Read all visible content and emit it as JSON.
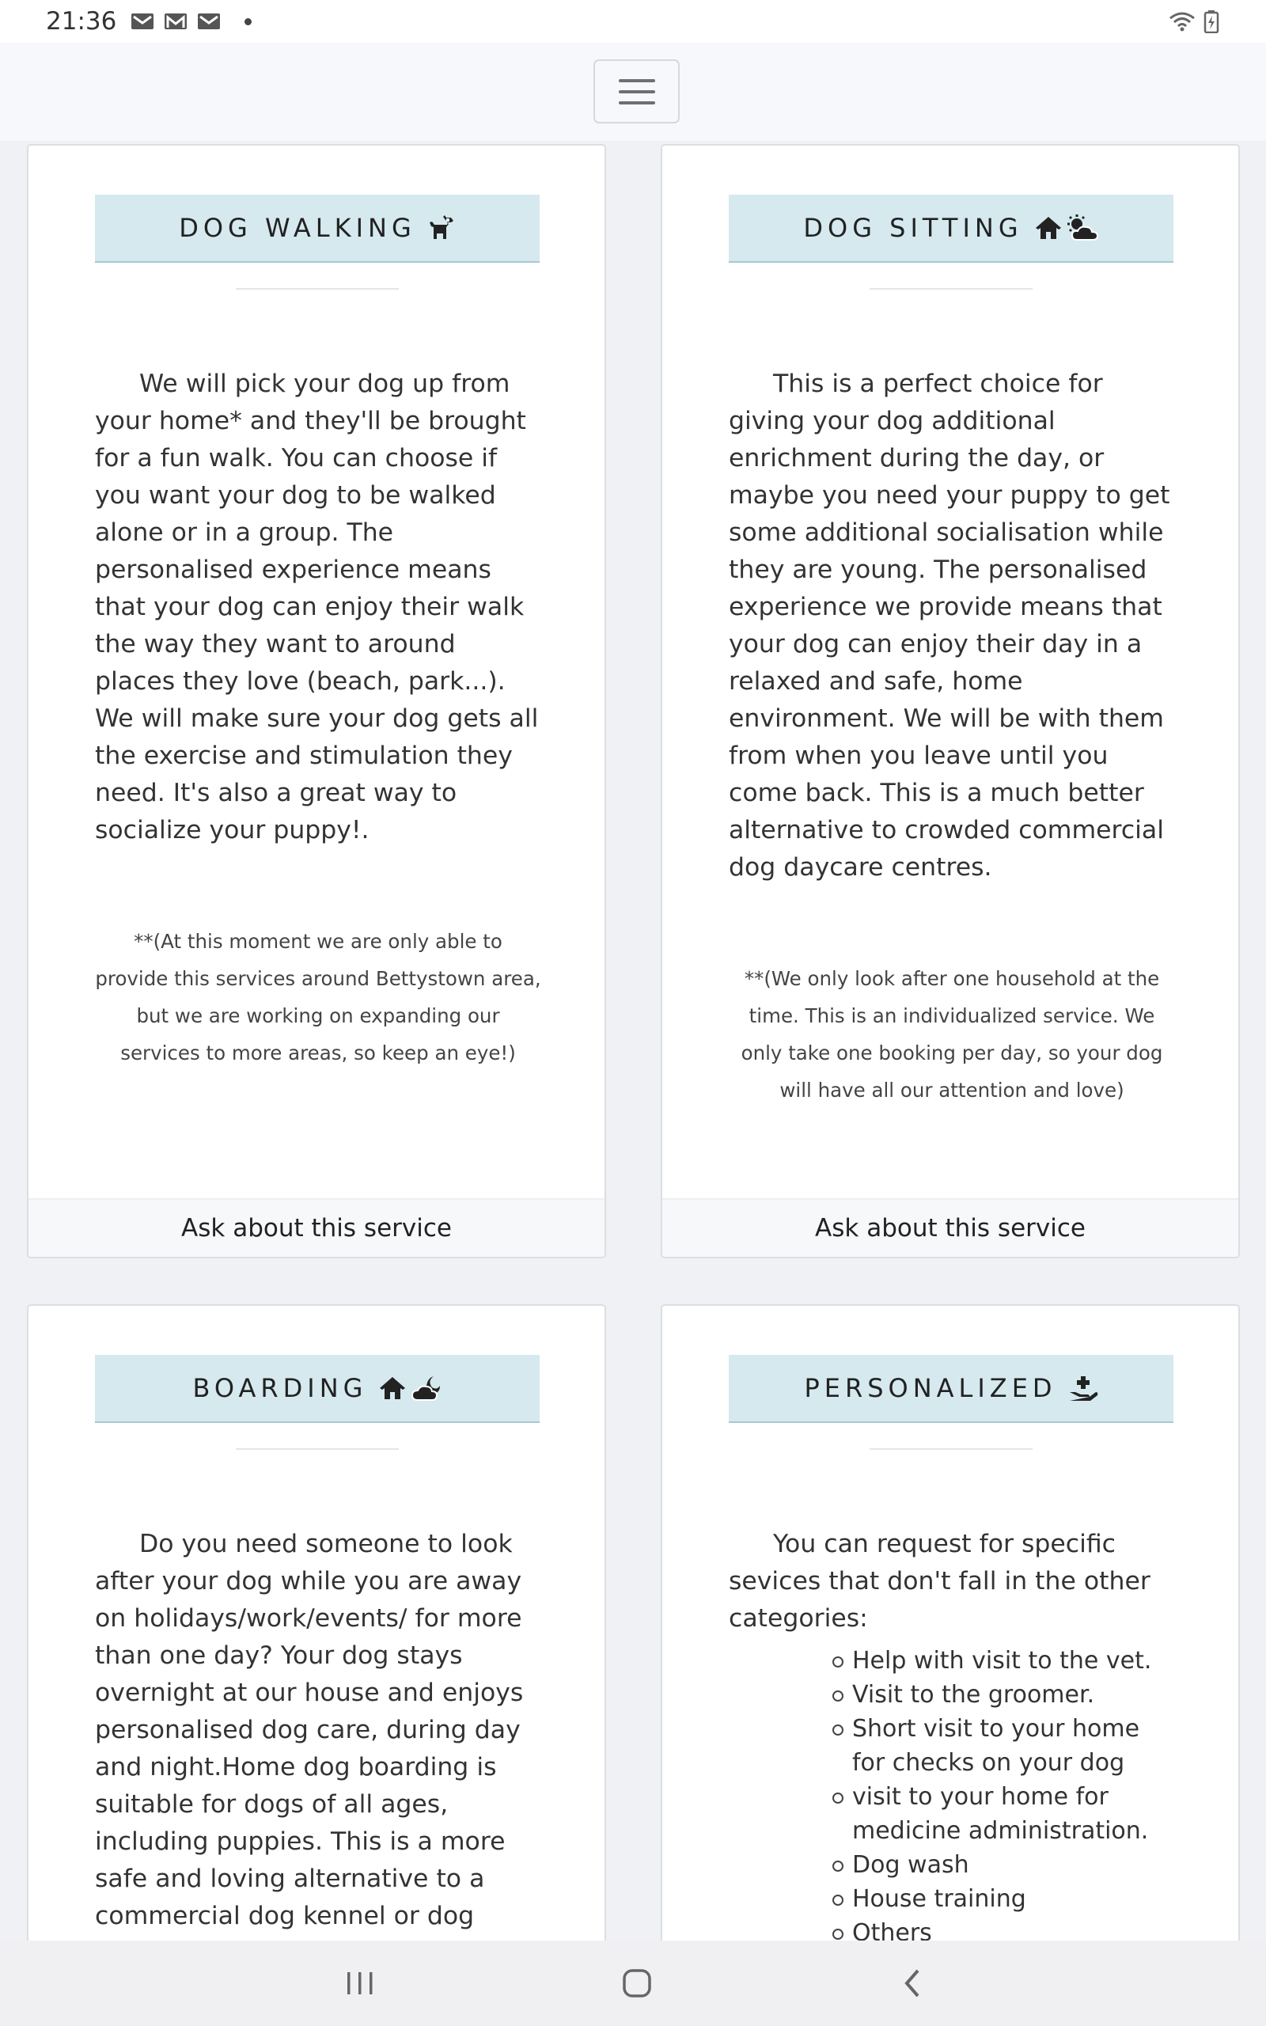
{
  "status_bar": {
    "time": "21:36",
    "notification_icons": [
      "mail-icon",
      "gmail-icon",
      "mail-icon"
    ],
    "right_icons": [
      "wifi-icon",
      "battery-charging-icon"
    ]
  },
  "navbar": {
    "toggler_icon": "hamburger-icon"
  },
  "cards": [
    {
      "title": "DOG WALKING",
      "icons": [
        "dog-icon"
      ],
      "body": "We will pick your dog up from your home* and they'll be brought for a fun walk. You can choose if you want your dog to be walked alone or in a group. The personalised experience means that your dog can enjoy their walk the way they want to around places they love (beach, park...). We will make sure your dog gets all the exercise and stimulation they need. It's also a great way to socialize your puppy!.",
      "note": "**(At this moment we are only able to provide this services around Bettystown area, but we are working on expanding our services to more areas, so keep an eye!)",
      "footer": "Ask about this service"
    },
    {
      "title": "DOG SITTING",
      "icons": [
        "house-icon",
        "cloud-sun-icon"
      ],
      "body": "This is a perfect choice for giving your dog additional enrichment during the day, or maybe you need your puppy to get some additional socialisation while they are young. The personalised experience we provide means that your dog can enjoy their day in a relaxed and safe, home environment. We will be with them from when you leave until you come back. This is a much better alternative to crowded commercial dog daycare centres.",
      "note": "**(We only look after one household at the time. This is an individualized service. We only take one booking per day, so your dog will have all our attention and love)",
      "footer": "Ask about this service"
    },
    {
      "title": "BOARDING",
      "icons": [
        "house-icon",
        "cloud-moon-icon"
      ],
      "body": "Do you need someone to look after your dog while you are away on holidays/work/events/ for more than one day? Your dog stays overnight at our house and enjoys personalised dog care, during day and night.Home dog boarding is suitable for dogs of all ages, including puppies. This is a more safe and loving alternative to a commercial dog kennel or dog kennel."
    },
    {
      "title": "PERSONALIZED",
      "icons": [
        "hand-holding-medical-icon"
      ],
      "body": "You can request for specific sevices that don't fall in the other categories:",
      "list": [
        "Help with visit to the vet.",
        "Visit to the groomer.",
        "Short visit to your home for checks on your dog",
        "visit to your home for medicine administration.",
        "Dog wash",
        "House training",
        "Others"
      ]
    }
  ],
  "bottom_nav": [
    "recent-apps-icon",
    "home-icon",
    "back-icon"
  ]
}
